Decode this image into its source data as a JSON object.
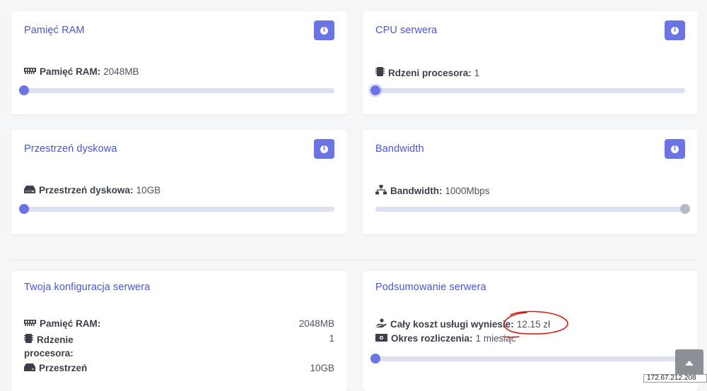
{
  "cards": {
    "ram": {
      "title": "Pamięć RAM",
      "label": "Pamięć RAM:",
      "value": "2048MB",
      "slider_fraction": 0.0
    },
    "cpu": {
      "title": "CPU serwera",
      "label": "Rdzeni procesora:",
      "value": "1",
      "slider_fraction": 0.0
    },
    "disk": {
      "title": "Przestrzeń dyskowa",
      "label": "Przestrzeń dyskowa:",
      "value": "10GB",
      "slider_fraction": 0.0
    },
    "bandwidth": {
      "title": "Bandwidth",
      "label": "Bandwidth:",
      "value": "1000Mbps",
      "slider_fraction": 1.0
    }
  },
  "config": {
    "title": "Twoja konfiguracja serwera",
    "rows": [
      {
        "label": "Pamięć RAM:",
        "value": "2048MB",
        "icon": "memory-icon"
      },
      {
        "label_line1": "Rdzenie",
        "label_line2": "procesora:",
        "value": "1",
        "icon": "cpu-chip-icon"
      },
      {
        "label": "Przestrzeń",
        "value": "10GB",
        "icon": "hdd-icon"
      }
    ]
  },
  "summary": {
    "title": "Podsumowanie serwera",
    "cost_label": "Cały koszt usługi wyniesie:",
    "cost_value": "12.15 zł",
    "period_label": "Okres rozliczenia:",
    "period_value": "1 miesiąc",
    "slider_fraction": 0.0
  },
  "overlay": {
    "ip_text": "172.67.212.208"
  },
  "colors": {
    "accent": "#6a74e4",
    "title": "#4a55d6",
    "annotation": "#d11a1a"
  }
}
